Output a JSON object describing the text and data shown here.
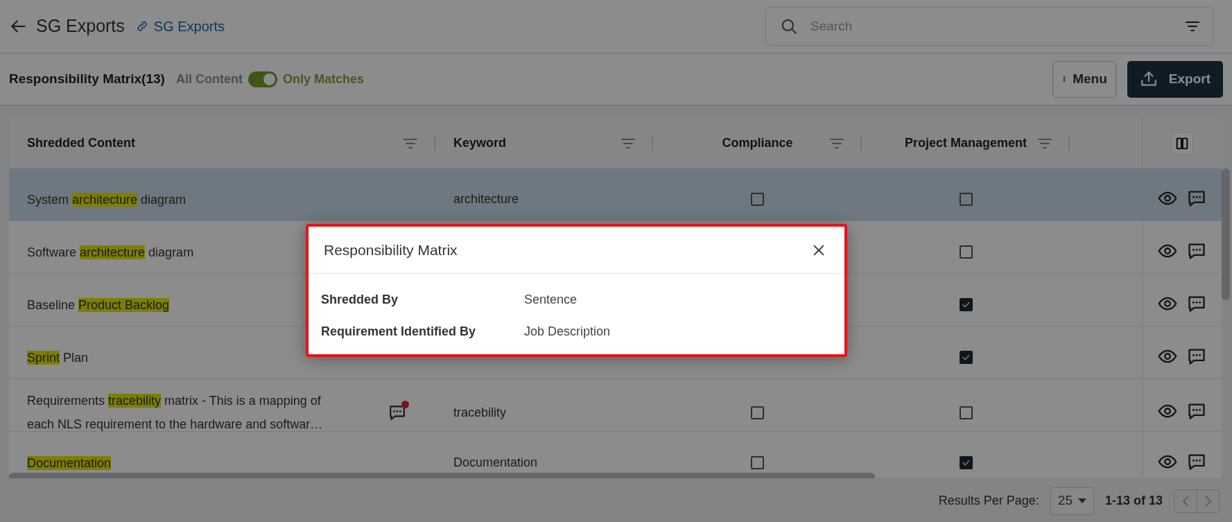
{
  "header": {
    "title": "SG Exports",
    "link": "SG Exports",
    "search": {
      "placeholder": "Search"
    }
  },
  "toolbar": {
    "title": "Responsibility Matrix(13)",
    "toggle": {
      "off_label": "All Content",
      "on_label": "Only Matches",
      "on": true
    },
    "buttons": [
      {
        "kind": "menu",
        "label": "Menu"
      },
      {
        "kind": "export",
        "label": "Export"
      }
    ]
  },
  "table": {
    "columns": [
      {
        "label": "Shredded Content"
      },
      {
        "label": "Keyword"
      },
      {
        "label": "Compliance"
      },
      {
        "label": "Project Management"
      }
    ],
    "rows": [
      {
        "selected": true,
        "note": false,
        "content": [
          [
            {
              "text": "System "
            },
            {
              "text": "architecture",
              "match": true
            },
            {
              "text": " diagram"
            }
          ]
        ],
        "keyword": "architecture",
        "compliance": false,
        "project_management": false
      },
      {
        "selected": false,
        "note": false,
        "content": [
          [
            {
              "text": "Software "
            },
            {
              "text": "architecture",
              "match": true
            },
            {
              "text": " diagram"
            }
          ]
        ],
        "project_management": false
      },
      {
        "selected": false,
        "note": false,
        "content": [
          [
            {
              "text": "Baseline "
            },
            {
              "text": "Product Backlog",
              "match": true
            }
          ]
        ],
        "project_management": true
      },
      {
        "selected": false,
        "note": false,
        "content": [
          [
            {
              "text": "Sprint",
              "match": true
            },
            {
              "text": " Plan"
            }
          ]
        ],
        "project_management": true
      },
      {
        "selected": false,
        "note": true,
        "content": [
          [
            {
              "text": "Requirements "
            },
            {
              "text": "tracebility",
              "match": true
            },
            {
              "text": " matrix - This is a mapping of"
            }
          ],
          [
            {
              "text": "each NLS requirement to the hardware and softwar…"
            }
          ]
        ],
        "keyword": "tracebility",
        "compliance": false,
        "project_management": false
      },
      {
        "selected": false,
        "note": false,
        "content": [
          [
            {
              "text": "Documentation",
              "match": true
            }
          ]
        ],
        "keyword": "Documentation",
        "compliance": false,
        "project_management": true
      }
    ]
  },
  "pagination": {
    "label": "Results Per Page:",
    "per_page": "25",
    "range": "1-13 of 13"
  },
  "modal": {
    "title": "Responsibility Matrix",
    "fields": [
      {
        "label": "Shredded By",
        "value": "Sentence"
      },
      {
        "label": "Requirement Identified By",
        "value": "Job Description"
      }
    ]
  }
}
